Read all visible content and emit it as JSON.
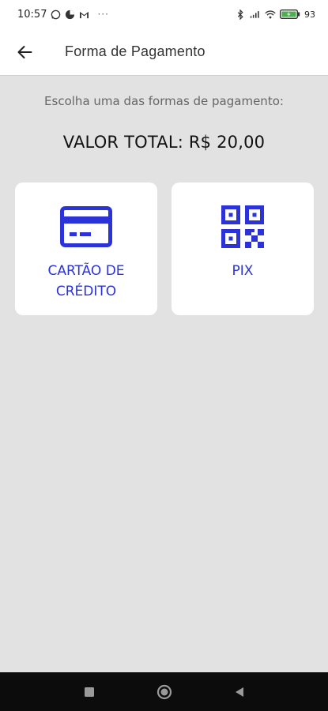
{
  "status_bar": {
    "time": "10:57",
    "extra": "···",
    "battery": "93"
  },
  "app_bar": {
    "title": "Forma de Pagamento"
  },
  "content": {
    "instruction": "Escolha uma das formas de pagamento:",
    "total": "VALOR TOTAL: R$ 20,00"
  },
  "options": [
    {
      "label": "CARTÃO DE CRÉDITO",
      "icon": "credit-card-icon"
    },
    {
      "label": "PIX",
      "icon": "qr-code-icon"
    }
  ],
  "colors": {
    "accent": "#2b33d8",
    "background": "#e2e2e2",
    "card": "#ffffff"
  }
}
